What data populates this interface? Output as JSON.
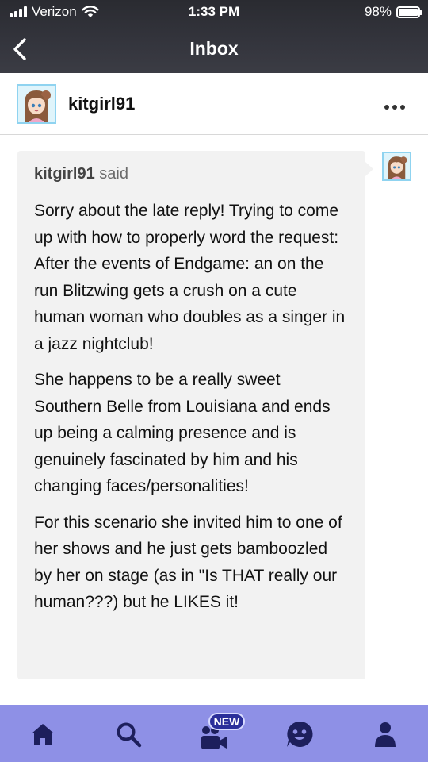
{
  "status_bar": {
    "carrier": "Verizon",
    "time": "1:33 PM",
    "battery": "98%",
    "battery_level": 0.98
  },
  "nav": {
    "title": "Inbox"
  },
  "conversation": {
    "username": "kitgirl91"
  },
  "message": {
    "sender": "kitgirl91",
    "said": "said",
    "paragraphs": [
      "Sorry about the late reply! Trying to come up with how to properly word the request: After the events of Endgame: an on the run Blitzwing gets a crush on a cute human woman who doubles as a singer in a jazz nightclub!",
      "She happens to be a really sweet Southern Belle from Louisiana and ends up being a calming presence and is genuinely fascinated by him and his changing faces/personalities!",
      "For this scenario she invited him to one of her shows and he just gets bamboozled by her on stage (as in \"Is THAT really our human???) but he LIKES it!"
    ]
  },
  "tabbar": {
    "badge": "NEW",
    "background_color": "#8e90e6",
    "icon_color": "#1d1f5c",
    "icons": [
      "home-icon",
      "search-icon",
      "video-icon",
      "chat-icon",
      "account-icon"
    ]
  }
}
